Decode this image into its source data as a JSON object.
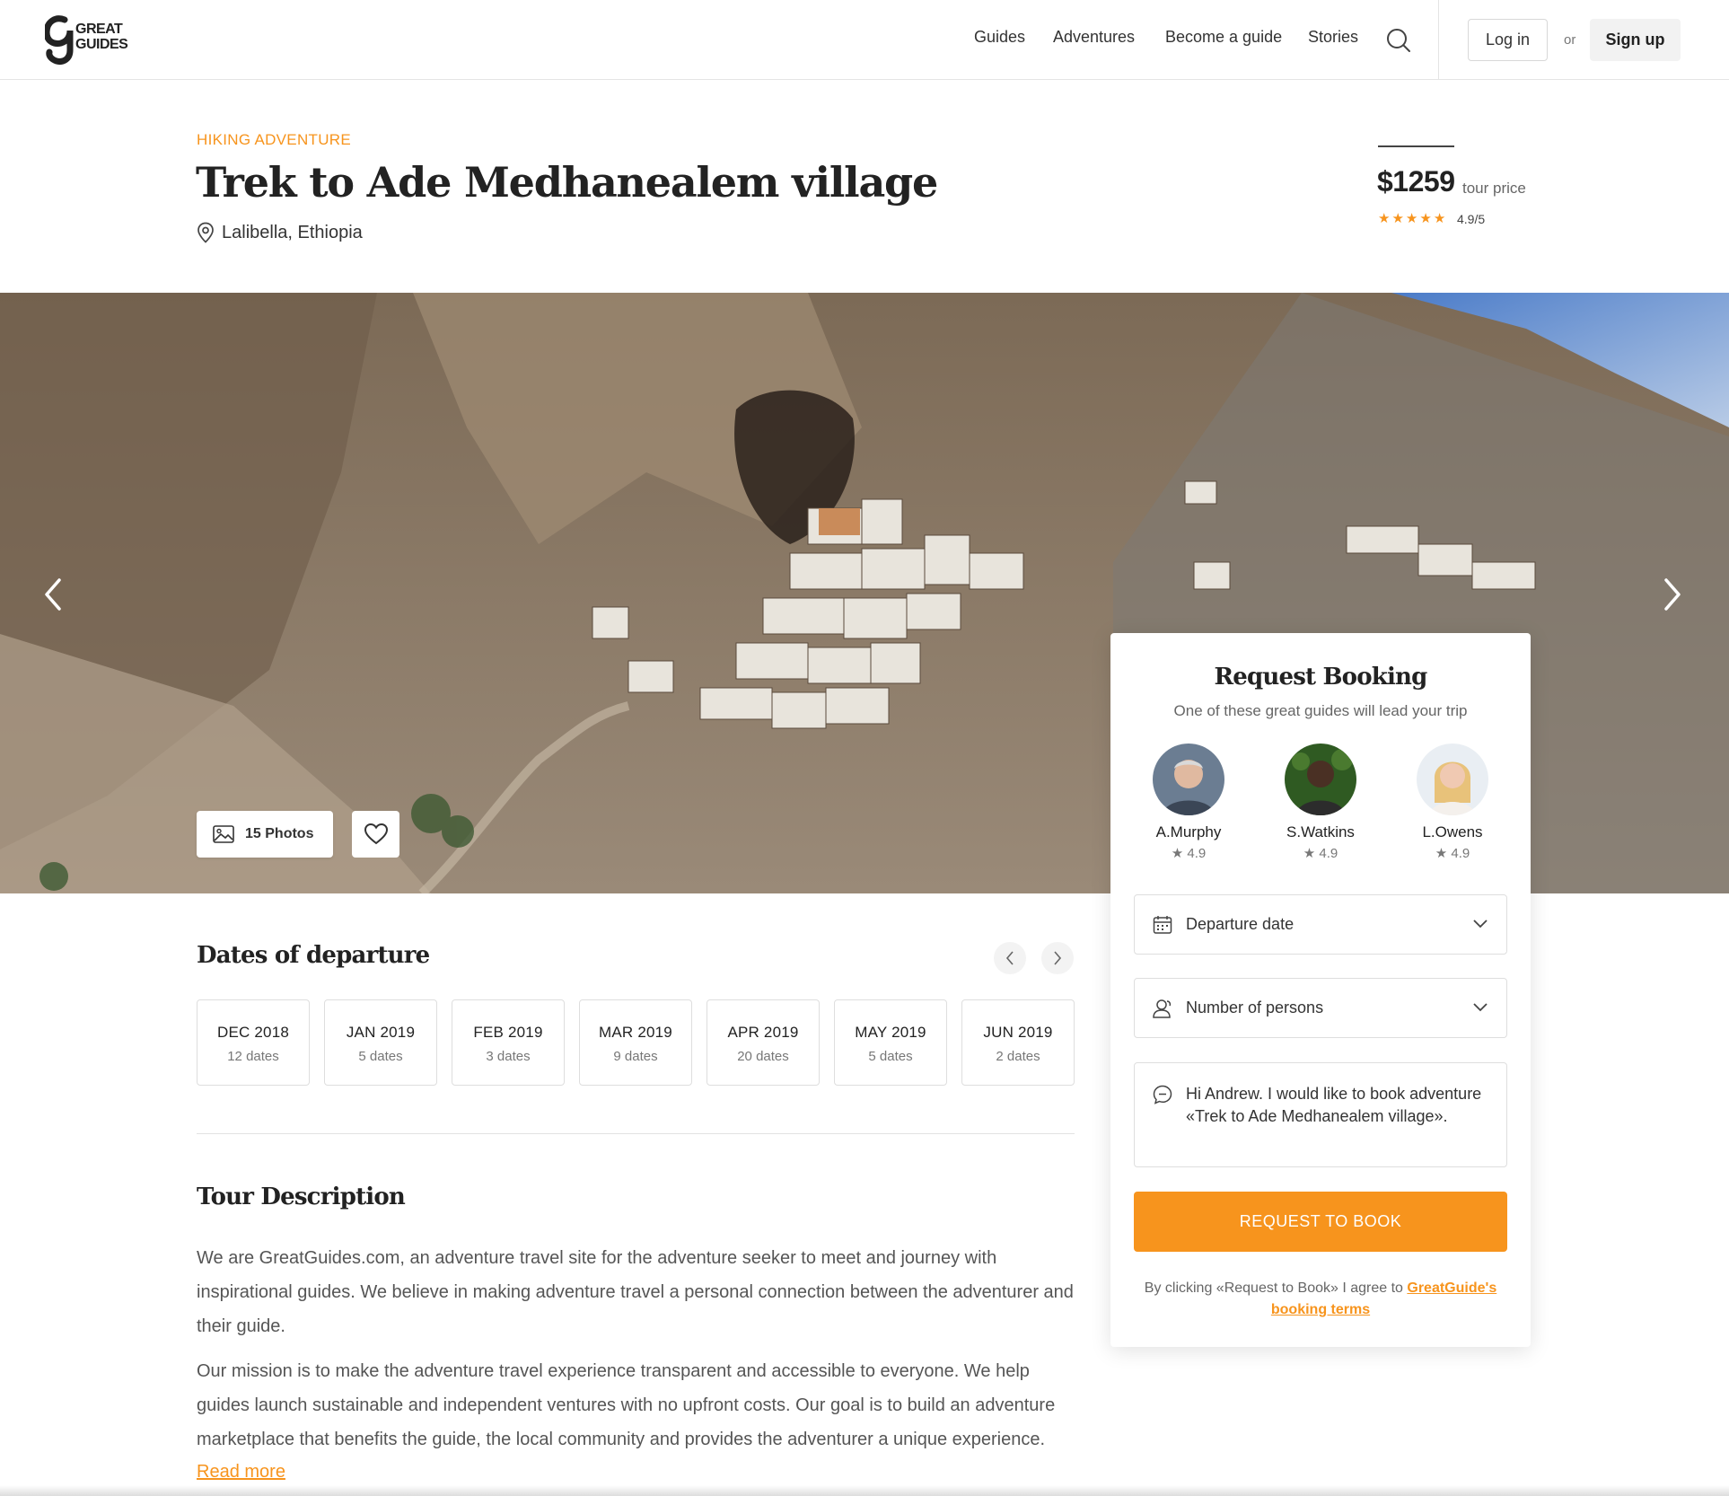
{
  "brand": {
    "logo_line1": "GREAT",
    "logo_line2": "GUIDES",
    "accent": "#f7941d"
  },
  "nav": {
    "items": [
      "Guides",
      "Adventures",
      "Become a guide",
      "Stories"
    ],
    "login": "Log in",
    "or": "or",
    "signup": "Sign up"
  },
  "tour": {
    "category": "HIKING ADVENTURE",
    "title": "Trek to Ade Medhanealem village",
    "location": "Lalibella, Ethiopia",
    "price": "$1259",
    "price_label": "tour price",
    "rating_stars": 5,
    "rating": "4.9/5"
  },
  "gallery": {
    "photos_label": "15 Photos"
  },
  "dates": {
    "title": "Dates of departure",
    "items": [
      {
        "month": "DEC 2018",
        "count": "12 dates"
      },
      {
        "month": "JAN 2019",
        "count": "5 dates"
      },
      {
        "month": "FEB 2019",
        "count": "3 dates"
      },
      {
        "month": "MAR 2019",
        "count": "9 dates"
      },
      {
        "month": "APR 2019",
        "count": "20 dates"
      },
      {
        "month": "MAY 2019",
        "count": "5 dates"
      },
      {
        "month": "JUN 2019",
        "count": "2 dates"
      }
    ]
  },
  "description": {
    "title": "Tour Description",
    "p1": "We are GreatGuides.com, an adventure travel site for the adventure seeker to meet and journey with inspirational guides. We believe in making adventure travel a personal connection between the adventurer and their guide.",
    "p2": "Our mission is to make the adventure travel experience transparent and accessible to everyone. We help guides launch sustainable and independent ventures with no upfront costs. Our goal is to build an adventure marketplace that benefits the guide, the local community and provides the adventurer a unique experience.",
    "read_more": "Read more"
  },
  "booking": {
    "title": "Request Booking",
    "subtitle": "One of these great guides will lead your trip",
    "guides": [
      {
        "name": "A.Murphy",
        "rating": "★ 4.9"
      },
      {
        "name": "S.Watkins",
        "rating": "★ 4.9"
      },
      {
        "name": "L.Owens",
        "rating": "★ 4.9"
      }
    ],
    "departure_label": "Departure date",
    "persons_label": "Number of persons",
    "message": "Hi Andrew. I would like to book adventure «Trek to Ade Medhanealem village».",
    "request_button": "REQUEST TO BOOK",
    "terms_prefix": "By clicking «Request to Book» I agree to ",
    "terms_link": "GreatGuide's booking terms"
  }
}
